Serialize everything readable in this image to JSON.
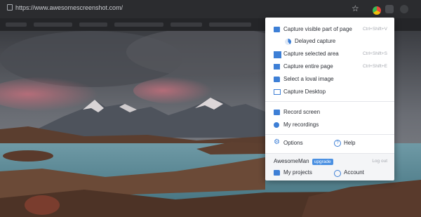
{
  "browser": {
    "url": "https://www.awesomescreenshot.com/"
  },
  "menu": {
    "items": [
      {
        "label": "Capture visible part of page",
        "shortcut": "Ctrl+Shift+V",
        "icon": "visible-capture-icon"
      },
      {
        "label": "Delayed capture",
        "shortcut": "",
        "icon": "timer-icon"
      },
      {
        "label": "Capture selected area",
        "shortcut": "Ctrl+Shift+S",
        "icon": "selected-area-icon"
      },
      {
        "label": "Capture entire page",
        "shortcut": "Ctrl+Shift+E",
        "icon": "entire-page-icon"
      },
      {
        "label": "Select a loval image",
        "shortcut": "",
        "icon": "folder-icon"
      },
      {
        "label": "Capture Desktop",
        "shortcut": "",
        "icon": "desktop-icon"
      },
      {
        "label": "Record screen",
        "shortcut": "",
        "icon": "video-camera-icon"
      },
      {
        "label": "My recordings",
        "shortcut": "",
        "icon": "recordings-icon"
      },
      {
        "label": "Options",
        "icon": "gear-icon"
      },
      {
        "label": "Help",
        "icon": "help-icon"
      }
    ]
  },
  "footer": {
    "username": "AwesomeMan",
    "badge": "upgrade",
    "logout": "Log out",
    "projects": "My projects",
    "account": "Account"
  },
  "colors": {
    "accent": "#4a90e2"
  }
}
